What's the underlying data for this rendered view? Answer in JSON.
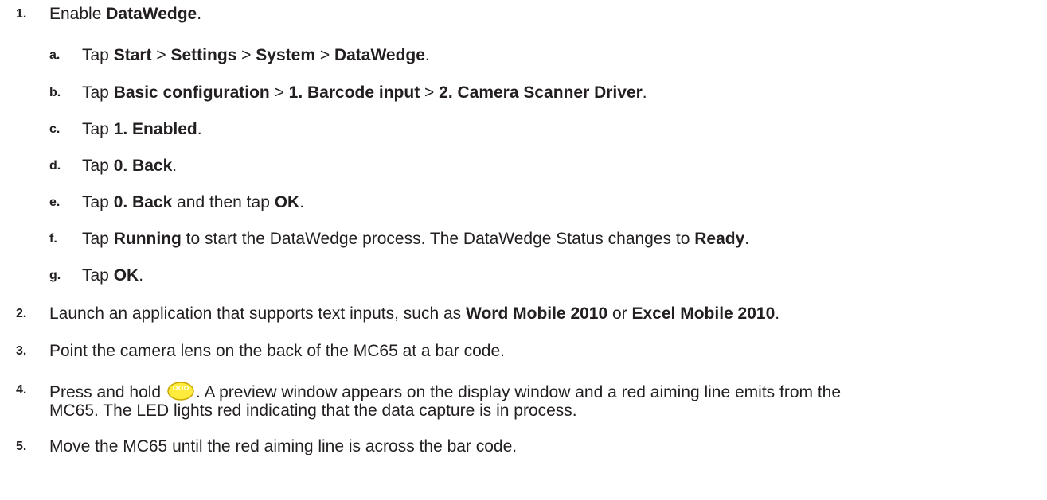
{
  "colors": {
    "text": "#231f20",
    "scan_key_fill": "#ffeb3b",
    "scan_key_outline": "#c8a800"
  },
  "steps": [
    {
      "number": "1.",
      "parts": [
        {
          "t": "Enable "
        },
        {
          "b": "DataWedge"
        },
        {
          "t": "."
        }
      ],
      "substeps": [
        {
          "letter": "a.",
          "parts": [
            {
              "t": "Tap "
            },
            {
              "b": "Start"
            },
            {
              "t": " > "
            },
            {
              "b": "Settings"
            },
            {
              "t": " > "
            },
            {
              "b": "System"
            },
            {
              "t": " > "
            },
            {
              "b": "DataWedge"
            },
            {
              "t": "."
            }
          ]
        },
        {
          "letter": "b.",
          "parts": [
            {
              "t": "Tap "
            },
            {
              "b": "Basic configuration"
            },
            {
              "t": " > "
            },
            {
              "b": "1. Barcode input"
            },
            {
              "t": " > "
            },
            {
              "b": "2. Camera Scanner Driver"
            },
            {
              "t": "."
            }
          ]
        },
        {
          "letter": "c.",
          "parts": [
            {
              "t": "Tap "
            },
            {
              "b": "1. Enabled"
            },
            {
              "t": "."
            }
          ]
        },
        {
          "letter": "d.",
          "parts": [
            {
              "t": "Tap "
            },
            {
              "b": "0. Back"
            },
            {
              "t": "."
            }
          ]
        },
        {
          "letter": "e.",
          "parts": [
            {
              "t": "Tap "
            },
            {
              "b": "0. Back"
            },
            {
              "t": " and then tap "
            },
            {
              "b": "OK"
            },
            {
              "t": "."
            }
          ]
        },
        {
          "letter": "f.",
          "parts": [
            {
              "t": "Tap "
            },
            {
              "b": "Running"
            },
            {
              "t": " to start the DataWedge process. The DataWedge Status changes to "
            },
            {
              "b": "Ready"
            },
            {
              "t": "."
            }
          ]
        },
        {
          "letter": "g.",
          "parts": [
            {
              "t": "Tap "
            },
            {
              "b": "OK"
            },
            {
              "t": "."
            }
          ]
        }
      ]
    },
    {
      "number": "2.",
      "parts": [
        {
          "t": "Launch an application that supports text inputs, such as "
        },
        {
          "b": "Word Mobile 2010"
        },
        {
          "t": " or "
        },
        {
          "b": "Excel Mobile 2010"
        },
        {
          "t": "."
        }
      ]
    },
    {
      "number": "3.",
      "parts": [
        {
          "t": "Point the camera lens on the back of the MC65 at a bar code."
        }
      ]
    },
    {
      "number": "4.",
      "parts": [
        {
          "t": "Press and hold "
        },
        {
          "icon": "scan-key-icon"
        },
        {
          "t": ". A preview window appears on the display window and a red aiming line emits from the"
        }
      ],
      "continuation": "MC65. The LED lights red indicating that the data capture is in process."
    },
    {
      "number": "5.",
      "parts": [
        {
          "t": "Move the MC65 until the red aiming line is across the bar code."
        }
      ]
    }
  ]
}
